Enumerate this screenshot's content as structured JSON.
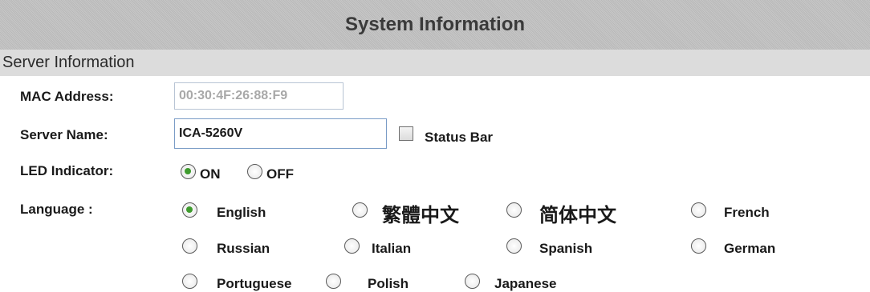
{
  "title": "System Information",
  "section": "Server Information",
  "mac": {
    "label": "MAC Address:",
    "value": "00:30:4F:26:88:F9"
  },
  "server_name": {
    "label": "Server Name:",
    "value": "ICA-5260V"
  },
  "status_bar": {
    "label": "Status Bar",
    "checked": false
  },
  "led": {
    "label": "LED Indicator:",
    "options": [
      "ON",
      "OFF"
    ],
    "selected": "ON"
  },
  "language": {
    "label": "Language :",
    "options": [
      "English",
      "繁體中文",
      "简体中文",
      "French",
      "Russian",
      "Italian",
      "Spanish",
      "German",
      "Portuguese",
      "Polish",
      "Japanese"
    ],
    "selected": "English"
  }
}
